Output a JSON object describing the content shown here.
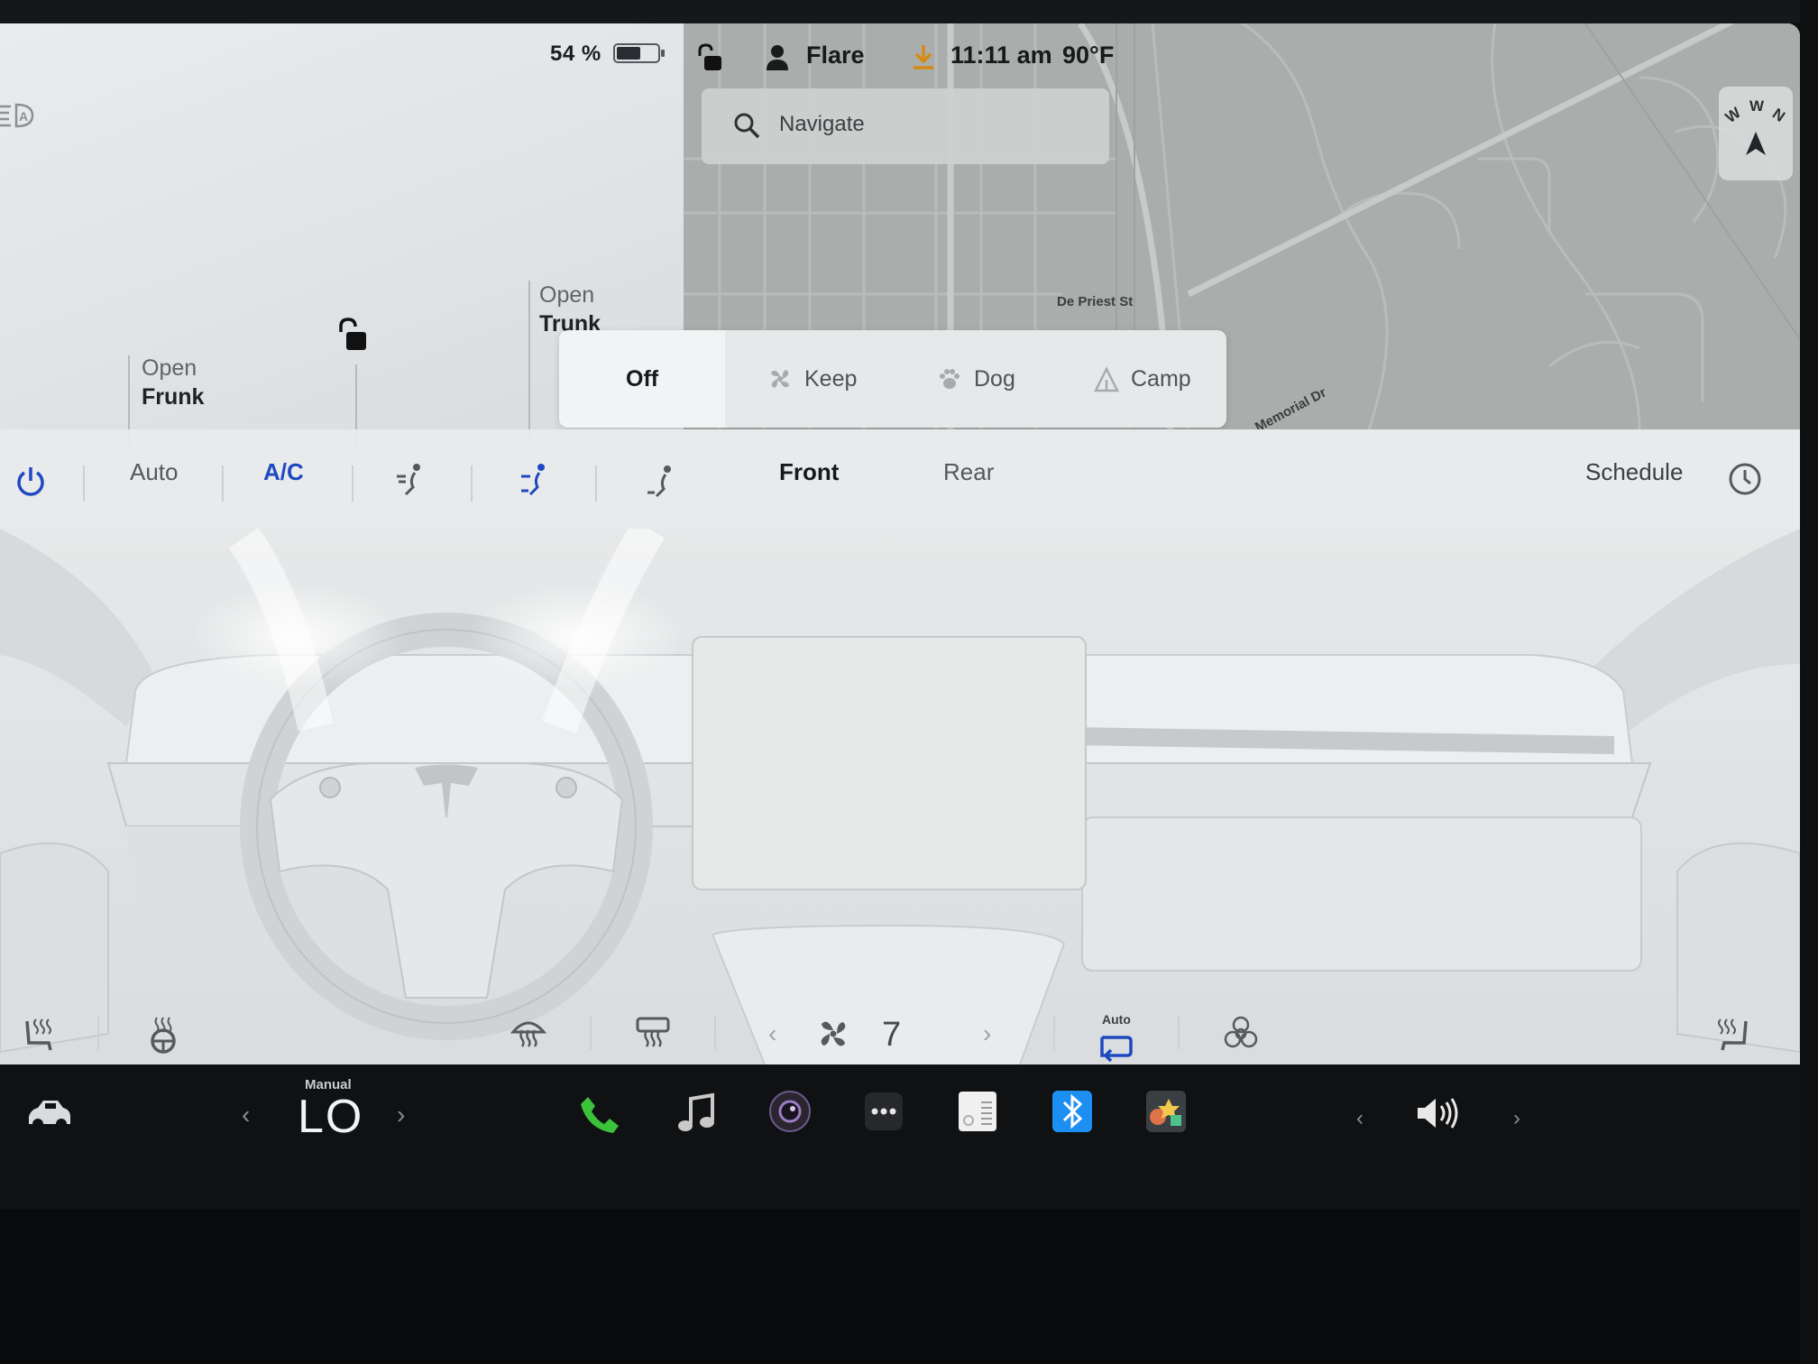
{
  "status": {
    "battery_percent": "54 %",
    "battery_level": 0.54
  },
  "car": {
    "frunk_action": "Open",
    "frunk_name": "Frunk",
    "trunk_action": "Open",
    "trunk_name": "Trunk"
  },
  "header": {
    "profile_name": "Flare",
    "time": "11:11 am",
    "outside_temp": "90°F"
  },
  "map": {
    "navigate_placeholder": "Navigate",
    "compass": [
      "W",
      "W",
      "N"
    ],
    "streets": [
      "De Priest St",
      "Memorial Dr"
    ]
  },
  "cabin_mode": {
    "options": [
      "Off",
      "Keep",
      "Dog",
      "Camp"
    ],
    "selected": "Off"
  },
  "climate": {
    "auto_label": "Auto",
    "ac_label": "A/C",
    "front_label": "Front",
    "rear_label": "Rear",
    "schedule_label": "Schedule",
    "fan_speed": "7",
    "recirc_mode_label": "Auto",
    "accent_color": "#1f49c0"
  },
  "dock": {
    "temp_mode_label": "Manual",
    "temp_value": "LO",
    "apps": [
      "phone-icon",
      "music-icon",
      "camera-icon",
      "more-icon",
      "calendar-icon",
      "bluetooth-icon",
      "toybox-icon"
    ]
  }
}
